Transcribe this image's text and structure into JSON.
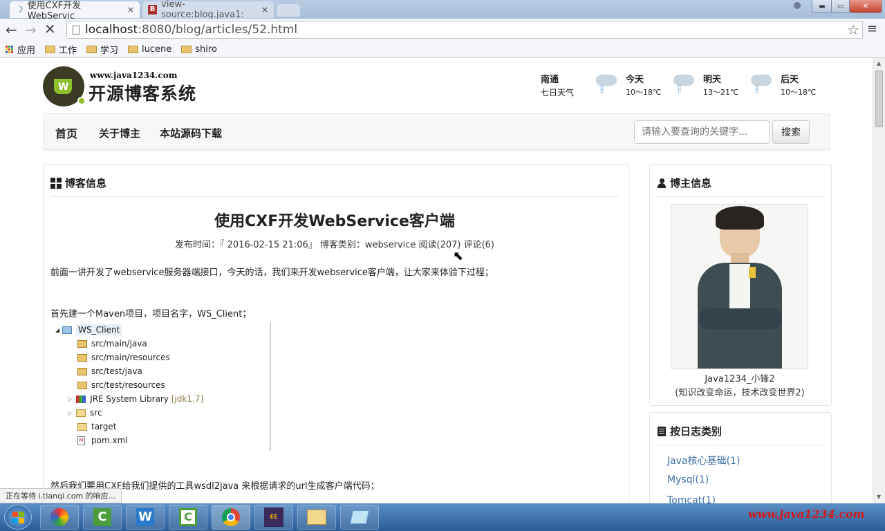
{
  "browser": {
    "tabs": [
      {
        "title": "使用CXF开发WebServic",
        "close": "×"
      },
      {
        "title": "view-source:blog.java1:",
        "close": "×"
      }
    ],
    "window_buttons": [
      "▬",
      "▭",
      "✕"
    ],
    "url_host": "localhost",
    "url_rest": ":8080/blog/articles/52.html",
    "bookmarks": [
      "应用",
      "工作",
      "学习",
      "lucene",
      "shiro"
    ],
    "status_text": "正在等待 i.tianqi.com 的响应..."
  },
  "site": {
    "logo_domain": "www.java1234.com",
    "logo_name": "开源博客系统",
    "weather": {
      "city": "南通",
      "label": "七日天气",
      "days": [
        {
          "name": "今天",
          "temp": "10～18℃"
        },
        {
          "name": "明天",
          "temp": "13～21℃"
        },
        {
          "name": "后天",
          "temp": "10～18℃"
        }
      ]
    },
    "nav": [
      "首页",
      "关于博主",
      "本站源码下载"
    ],
    "search_placeholder": "请输入要查询的关键字...",
    "search_button": "搜索"
  },
  "article": {
    "panel_title": "博客信息",
    "title": "使用CXF开发WebService客户端",
    "meta": "发布时间：『 2016-02-15 21:06』 博客类别：webservice  阅读(207) 评论(6)",
    "p1": "前面一讲开发了webservice服务器端接口，今天的话，我们来开发webservice客户端，让大家来体验下过程；",
    "p2": "首先建一个Maven项目，项目名字，WS_Client；",
    "tree": [
      {
        "label": "WS_Client",
        "extra": ""
      },
      {
        "label": "src/main/java",
        "extra": ""
      },
      {
        "label": "src/main/resources",
        "extra": ""
      },
      {
        "label": "src/test/java",
        "extra": ""
      },
      {
        "label": "src/test/resources",
        "extra": ""
      },
      {
        "label": "JRE System Library",
        "extra": "[jdk1.7]"
      },
      {
        "label": "src",
        "extra": ""
      },
      {
        "label": "target",
        "extra": ""
      },
      {
        "label": "pom.xml",
        "extra": ""
      }
    ],
    "p3": "然后我们要用CXF给我们提供的工具wsdl2java 来根据请求的url生成客户端代码；"
  },
  "sidebar": {
    "blogger_title": "博主信息",
    "blogger_name": "Java1234_小锋2",
    "blogger_motto": "(知识改变命运，技术改变世界2)",
    "category_title": "按日志类别",
    "categories": [
      "Java核心基础(1)",
      "Mysql(1)",
      "Tomcat(1)"
    ]
  },
  "watermark": "www.java1234.com",
  "colors": {
    "link": "#3a6ea5",
    "taskbar": "#2b5d96",
    "watermark": "#d11a1a"
  }
}
